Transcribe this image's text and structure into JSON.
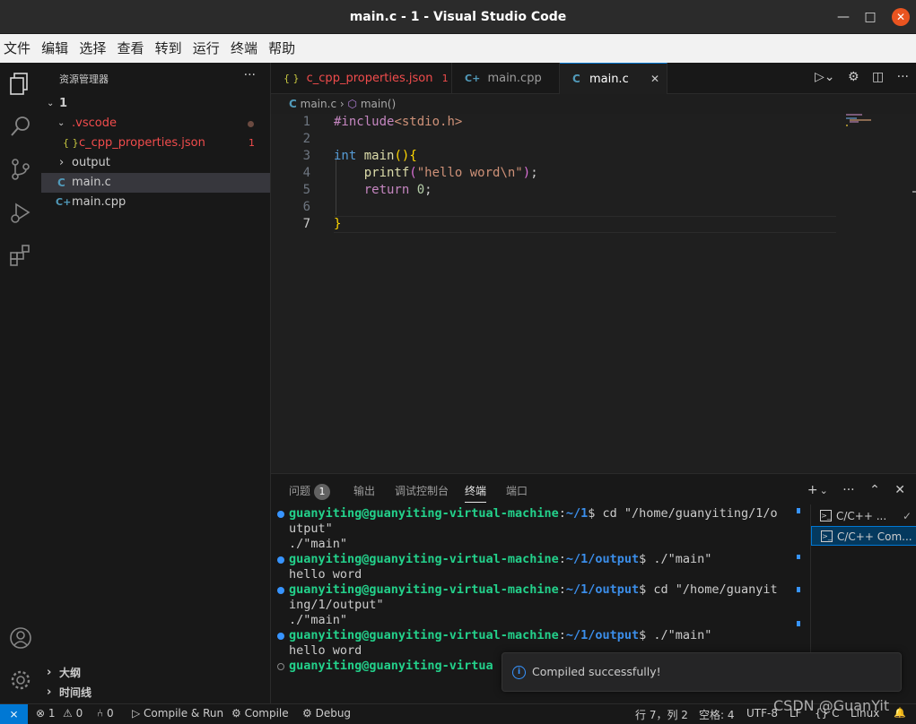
{
  "window": {
    "title": "main.c - 1 - Visual Studio Code",
    "min_symbol": "—",
    "max_symbol": "□",
    "close_symbol": "✕"
  },
  "menu": [
    "文件",
    "编辑",
    "选择",
    "查看",
    "转到",
    "运行",
    "终端",
    "帮助"
  ],
  "sidebar": {
    "header": "资源管理器",
    "more": "···",
    "root": "1",
    "items": [
      {
        "label": ".vscode",
        "chev": "⌄"
      },
      {
        "label": "c_cpp_properties.json",
        "icon": "{ }",
        "badge": "1"
      },
      {
        "label": "output",
        "chev": "›"
      },
      {
        "label": "main.c",
        "icon": "C"
      },
      {
        "label": "main.cpp",
        "icon": "C+"
      }
    ],
    "outline": "大纲",
    "timeline": "时间线"
  },
  "tabs": [
    {
      "label": "c_cpp_properties.json",
      "icon": "{ }",
      "badge": "1"
    },
    {
      "label": "main.cpp",
      "icon": "C+"
    },
    {
      "label": "main.c",
      "icon": "C",
      "close": "✕"
    }
  ],
  "breadcrumb": {
    "file": "main.c",
    "icon": "C",
    "sep": "›",
    "symbol": "main()"
  },
  "code": {
    "line_numbers": [
      "1",
      "2",
      "3",
      "4",
      "5",
      "6",
      "7"
    ]
  },
  "panel": {
    "tabs": [
      "问题",
      "输出",
      "调试控制台",
      "终端",
      "端口"
    ],
    "problems_count": "1",
    "actions": {
      "add": "+",
      "chevron": "⌄",
      "more": "···",
      "maximize": "⌃",
      "close": "✕"
    },
    "terminal_lines": [
      {
        "user": "guanyiting@guanyiting-virtual-machine",
        "path": "~/1",
        "cmd": "$ cd \"/home/guanyiting/1/o"
      },
      {
        "text": "utput\""
      },
      {
        "text": "./\"main\""
      },
      {
        "user": "guanyiting@guanyiting-virtual-machine",
        "path": "~/1/output",
        "cmd": "$ ./\"main\""
      },
      {
        "text": "hello word"
      },
      {
        "user": "guanyiting@guanyiting-virtual-machine",
        "path": "~/1/output",
        "cmd": "$ cd \"/home/guanyit"
      },
      {
        "text": "ing/1/output\""
      },
      {
        "text": "./\"main\""
      },
      {
        "user": "guanyiting@guanyiting-virtual-machine",
        "path": "~/1/output",
        "cmd": "$ ./\"main\""
      },
      {
        "text": "hello word"
      },
      {
        "user": "guanyiting@guanyiting-virtua",
        "path": "",
        "cmd": ""
      }
    ],
    "terminals": [
      {
        "label": "C/C++ ...",
        "check": "✓"
      },
      {
        "label": "C/C++ Com..."
      }
    ]
  },
  "notification": {
    "message": "Compiled successfully!",
    "icon": "i"
  },
  "statusbar": {
    "remote": "⨯",
    "errors": "⊗ 1",
    "warnings": "⚠ 0",
    "ports": "⑃ 0",
    "compile_run": "▷ Compile & Run",
    "compile": "⚙ Compile",
    "debug": "⚙ Debug",
    "cursor": "行 7，列 2",
    "spaces": "空格: 4",
    "encoding": "UTF-8",
    "eol": "LF",
    "lang": "{} C",
    "platform": "Linux",
    "bell": "🔔"
  },
  "watermark": "CSDN @GuanYit",
  "colors": {
    "accent": "#0078d4",
    "error": "#f14c4c",
    "json": "#cbcb41",
    "c_icon": "#519aba"
  }
}
